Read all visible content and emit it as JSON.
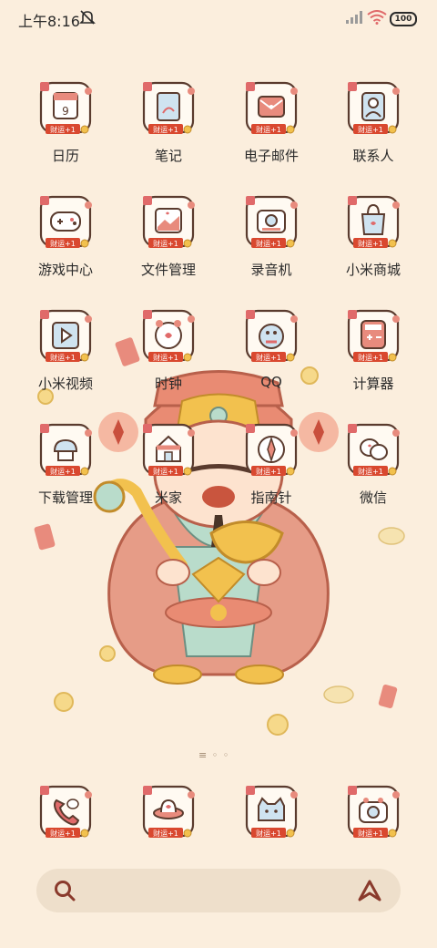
{
  "status_bar": {
    "time": "上午8:16",
    "battery": "100"
  },
  "badge_text": "财运+1",
  "apps": [
    {
      "label": "日历",
      "icon": "calendar-icon",
      "glyph": "9"
    },
    {
      "label": "笔记",
      "icon": "notes-icon",
      "glyph": ""
    },
    {
      "label": "电子邮件",
      "icon": "email-icon",
      "glyph": ""
    },
    {
      "label": "联系人",
      "icon": "contacts-icon",
      "glyph": ""
    },
    {
      "label": "游戏中心",
      "icon": "gamepad-icon",
      "glyph": ""
    },
    {
      "label": "文件管理",
      "icon": "folder-icon",
      "glyph": ""
    },
    {
      "label": "录音机",
      "icon": "recorder-icon",
      "glyph": ""
    },
    {
      "label": "小米商城",
      "icon": "shopping-bag-icon",
      "glyph": ""
    },
    {
      "label": "小米视频",
      "icon": "video-icon",
      "glyph": ""
    },
    {
      "label": "时钟",
      "icon": "clock-icon",
      "glyph": ""
    },
    {
      "label": "QQ",
      "icon": "qq-penguin-icon",
      "glyph": ""
    },
    {
      "label": "计算器",
      "icon": "calculator-icon",
      "glyph": ""
    },
    {
      "label": "下载管理",
      "icon": "download-icon",
      "glyph": ""
    },
    {
      "label": "米家",
      "icon": "mijia-house-icon",
      "glyph": ""
    },
    {
      "label": "指南针",
      "icon": "compass-icon",
      "glyph": ""
    },
    {
      "label": "微信",
      "icon": "wechat-icon",
      "glyph": ""
    }
  ],
  "dock": [
    {
      "icon": "phone-icon"
    },
    {
      "icon": "messages-ufo-icon"
    },
    {
      "icon": "cat-browser-icon"
    },
    {
      "icon": "camera-icon"
    }
  ],
  "colors": {
    "background": "#fbeedd",
    "accent_red": "#c0392b",
    "icon_outline": "#5a3b2e",
    "gold": "#f2c14e"
  }
}
